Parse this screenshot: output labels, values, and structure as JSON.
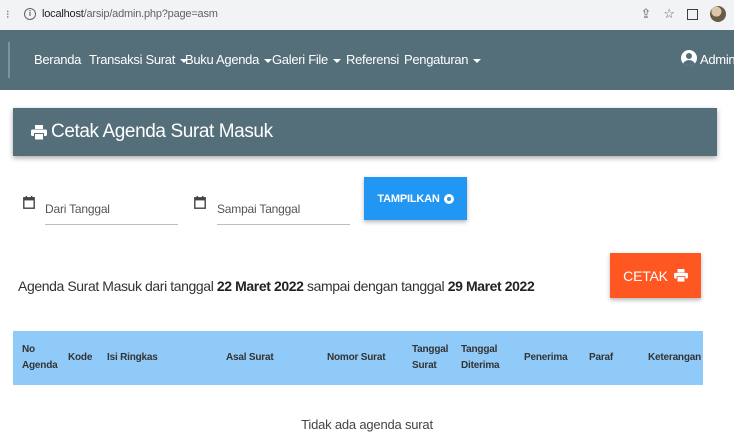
{
  "browser": {
    "url_host": "localhost",
    "url_path": "/arsip/admin.php?page=asm",
    "icons": [
      "info-icon",
      "share-icon",
      "star-icon",
      "sidepanel-icon",
      "profile-avatar"
    ]
  },
  "navbar": {
    "items": [
      {
        "label": "Beranda",
        "dropdown": false
      },
      {
        "label": "Transaksi Surat",
        "dropdown": true
      },
      {
        "label": "Buku Agenda",
        "dropdown": true
      },
      {
        "label": "Galeri File",
        "dropdown": true
      },
      {
        "label": "Referensi",
        "dropdown": false
      },
      {
        "label": "Pengaturan",
        "dropdown": true
      }
    ],
    "user_label": "Admin"
  },
  "page": {
    "title": "Cetak Agenda Surat Masuk",
    "title_icon": "printer-icon"
  },
  "filter": {
    "from_label": "Dari Tanggal",
    "to_label": "Sampai Tanggal",
    "show_button": "TAMPILKAN"
  },
  "range": {
    "prefix": "Agenda Surat Masuk dari tanggal ",
    "from_date": "22 Maret 2022",
    "middle": " sampai dengan tanggal ",
    "to_date": "29 Maret 2022"
  },
  "print_button": "CETAK",
  "table": {
    "headers": [
      "No\nAgenda",
      "Kode",
      "Isi Ringkas",
      "Asal Surat",
      "Nomor Surat",
      "Tanggal\nSurat",
      "Tanggal\nDiterima",
      "Penerima",
      "Paraf",
      "Keterangan"
    ],
    "empty_message": "Tidak ada agenda surat"
  },
  "colors": {
    "navbar": "#546e7a",
    "show_button": "#2196f3",
    "print_button": "#ff5722",
    "table_header": "#90caf9"
  }
}
